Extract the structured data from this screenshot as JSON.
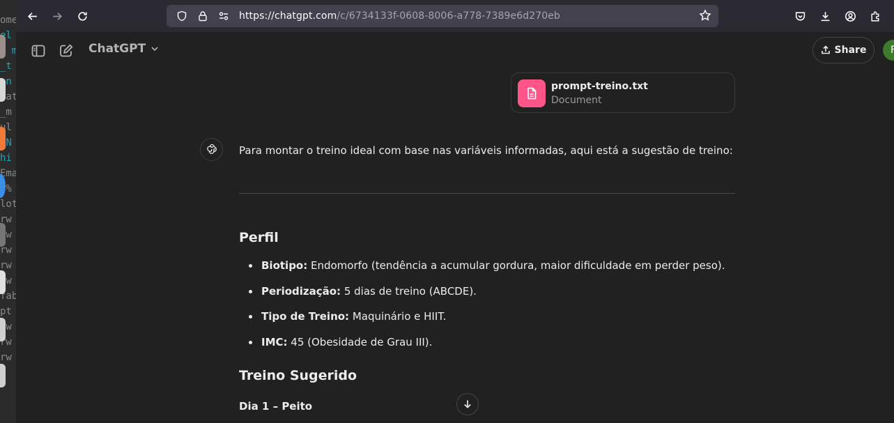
{
  "browser": {
    "url_host": "https://chatgpt.com",
    "url_path": "/c/6734133f-0608-8006-a778-7389e6d270eb"
  },
  "dock": {
    "terminal_lines": [
      "ome",
      "el",
      "s m",
      "_t",
      "an",
      "vat",
      "_m",
      "ul",
      "_N",
      "hi",
      "Ema",
      "8%",
      "lot",
      "rw",
      "rw",
      "rw",
      "rw",
      "rw",
      "fab",
      "pt",
      "rw",
      "rw",
      "rw"
    ]
  },
  "header": {
    "model_name": "ChatGPT",
    "share_label": "Share",
    "avatar_initial": "F"
  },
  "attachment": {
    "filename": "prompt-treino.txt",
    "type": "Document"
  },
  "message": {
    "intro": "Para montar o treino ideal com base nas variáveis informadas, aqui está a sugestão de treino:",
    "section1_title": "Perfil",
    "profile": [
      {
        "label": "Biotipo:",
        "value": " Endomorfo (tendência a acumular gordura, maior dificuldade em perder peso)."
      },
      {
        "label": "Periodização:",
        "value": " 5 dias de treino (ABCDE)."
      },
      {
        "label": "Tipo de Treino:",
        "value": " Maquinário e HIIT."
      },
      {
        "label": "IMC:",
        "value": " 45 (Obesidade de Grau III)."
      }
    ],
    "section2_title": "Treino Sugerido",
    "day1_title": "Dia 1 – Peito"
  },
  "colors": {
    "page_bg": "#212121",
    "browser_bar": "#2b2a33",
    "url_field": "#42414d",
    "file_icon_bg": "#ff5588",
    "avatar_bg": "#3d7a2b"
  }
}
